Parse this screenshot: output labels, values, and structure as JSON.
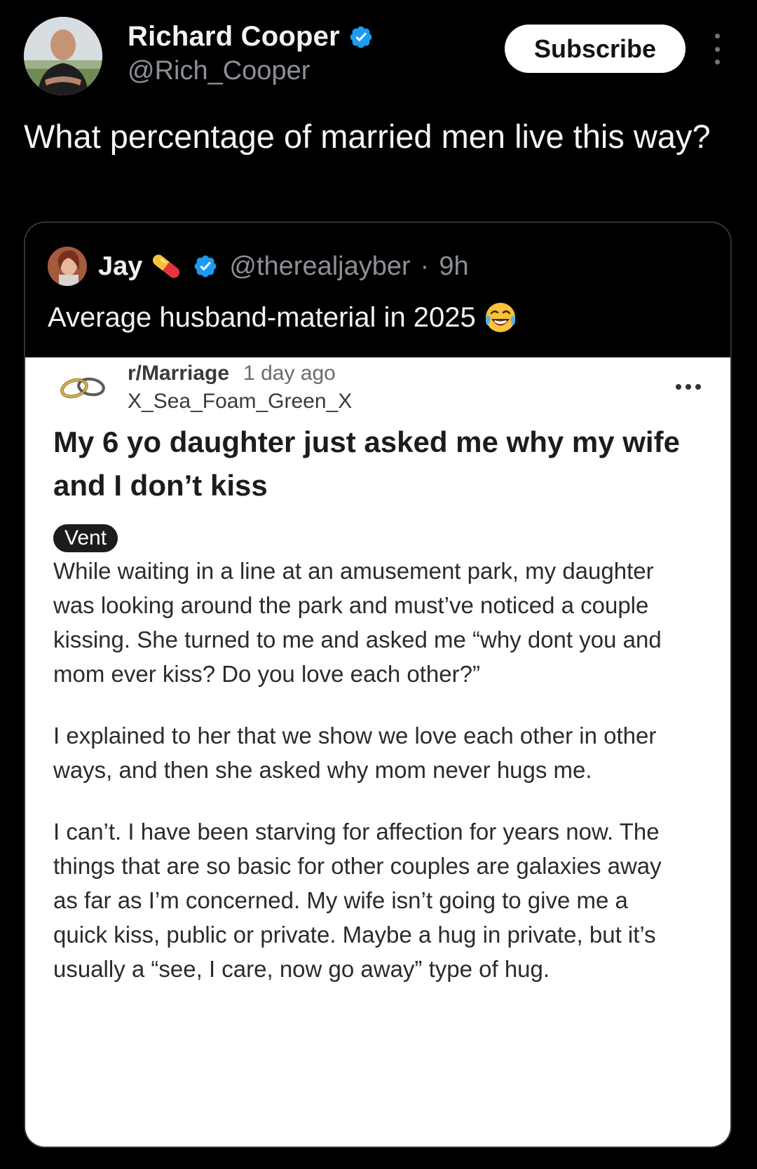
{
  "author": {
    "name": "Richard Cooper",
    "handle": "@Rich_Cooper",
    "verified": true
  },
  "actions": {
    "subscribe_label": "Subscribe",
    "more_icon": "more-vertical-icon"
  },
  "tweet": {
    "text": "What percentage of married men live this way?"
  },
  "quote": {
    "name": "Jay",
    "handle": "@therealjayber",
    "separator": "·",
    "time": "9h",
    "text": "Average husband-material in 2025",
    "name_emoji": "pill-icon",
    "text_emoji": "face-with-tears-of-joy-icon"
  },
  "reddit_post": {
    "subreddit": "r/Marriage",
    "age": "1 day ago",
    "username": "X_Sea_Foam_Green_X",
    "title": "My 6 yo daughter just asked me why my wife and I don’t kiss",
    "flair": "Vent",
    "paragraphs": [
      "While waiting in a line at an amusement park, my daughter was looking around the park and must’ve noticed a couple kissing. She turned to me and asked me “why dont you and mom ever kiss? Do you love each other?”",
      "I explained to her that we show we love each other in other ways, and then she asked why mom never hugs me.",
      "I can’t. I have been starving for affection for years now. The things that are so basic for other couples are galaxies away as far as I’m concerned. My wife isn’t going to give me a quick kiss, public or private. Maybe a hug in private, but it’s usually a “see, I care, now go away” type of hug."
    ]
  },
  "colors": {
    "background": "#000000",
    "verified_blue": "#1d9bf0",
    "muted_text": "#8b9097",
    "reddit_bg": "#ffffff"
  }
}
